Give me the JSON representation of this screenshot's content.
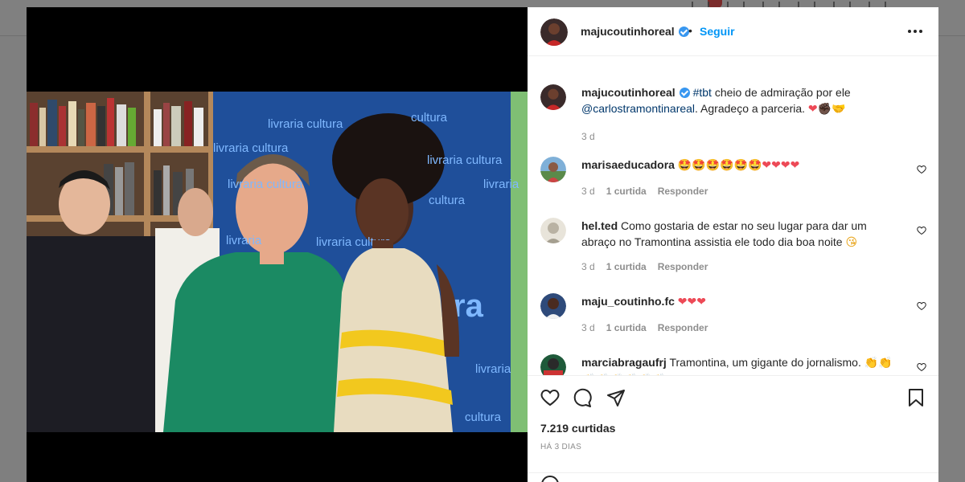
{
  "post": {
    "author": "majucoutinhoreal",
    "follow_label": "Seguir",
    "separator": "•",
    "caption": {
      "username": "majucoutinhoreal",
      "hashtag": "#tbt",
      "text_1": " cheio de admiração por ele",
      "mention": "@carlostramontinareal",
      "text_2": ". Agradeço a parceria. ",
      "emojis": "❤✊🏿🤝",
      "time": "3 d"
    },
    "likes": "7.219 curtidas",
    "posted_ago": "HÁ 3 DIAS"
  },
  "comments": [
    {
      "username": "marisaeducadora",
      "text": "",
      "emojis": "🤩🤩🤩🤩🤩🤩❤❤❤❤",
      "time": "3 d",
      "likes": "1 curtida",
      "reply": "Responder"
    },
    {
      "username": "hel.ted",
      "text": " Como gostaria de estar no seu lugar para dar um abraço no Tramontina assistia ele todo dia boa noite ",
      "emojis": "😘",
      "time": "3 d",
      "likes": "1 curtida",
      "reply": "Responder"
    },
    {
      "username": "maju_coutinho.fc",
      "text": "",
      "emojis": "❤❤❤",
      "time": "3 d",
      "likes": "1 curtida",
      "reply": "Responder"
    },
    {
      "username": "marciabragaufrj",
      "text": " Tramontina, um gigante do jornalismo. ",
      "emojis": "👏👏👏👏👏👏👏👏",
      "time": "",
      "likes": "",
      "reply": ""
    }
  ],
  "photo": {
    "banner_texts": [
      "livraria cultura",
      "cultura",
      "livraria cultura",
      "livraria cultura",
      "livraria cultura",
      "livraria",
      "cultura",
      "livraria",
      "livraria cultura",
      "ra",
      "livraria",
      "cultura"
    ]
  },
  "icons": {
    "more": "more-options-icon",
    "like": "heart-icon",
    "comment": "comment-icon",
    "share": "share-icon",
    "save": "bookmark-icon"
  },
  "colors": {
    "link": "#00376b",
    "follow": "#0095f6",
    "verified": "#3897f0",
    "secondary_text": "#8e8e8e"
  }
}
